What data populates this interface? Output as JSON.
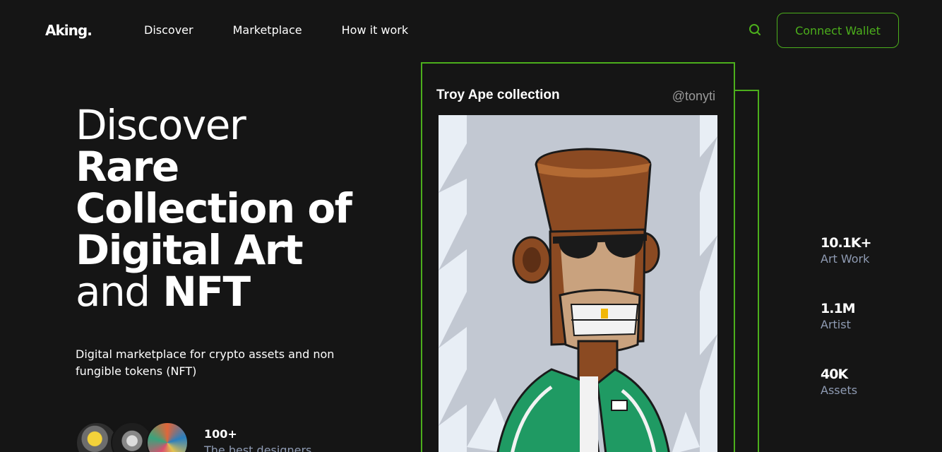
{
  "brand": {
    "logo": "Aking."
  },
  "nav": {
    "items": [
      "Discover",
      "Marketplace",
      "How it work"
    ]
  },
  "header": {
    "search_icon": "search-icon",
    "wallet_label": "Connect Wallet",
    "accent": "#4caf1c"
  },
  "hero": {
    "title_light_1": "Discover",
    "title_bold_1": "Rare Collection of Digital Art",
    "title_light_2": "and",
    "title_bold_2": "NFT",
    "subtitle": "Digital marketplace for crypto assets and non fungible tokens (NFT)",
    "designers_count": "100+",
    "designers_label": "The best designers"
  },
  "card": {
    "title": "Troy Ape collection",
    "handle": "@tonyti"
  },
  "stats": [
    {
      "value": "10.1K+",
      "label": "Art Work"
    },
    {
      "value": "1.1M",
      "label": "Artist"
    },
    {
      "value": "40K",
      "label": "Assets"
    }
  ]
}
